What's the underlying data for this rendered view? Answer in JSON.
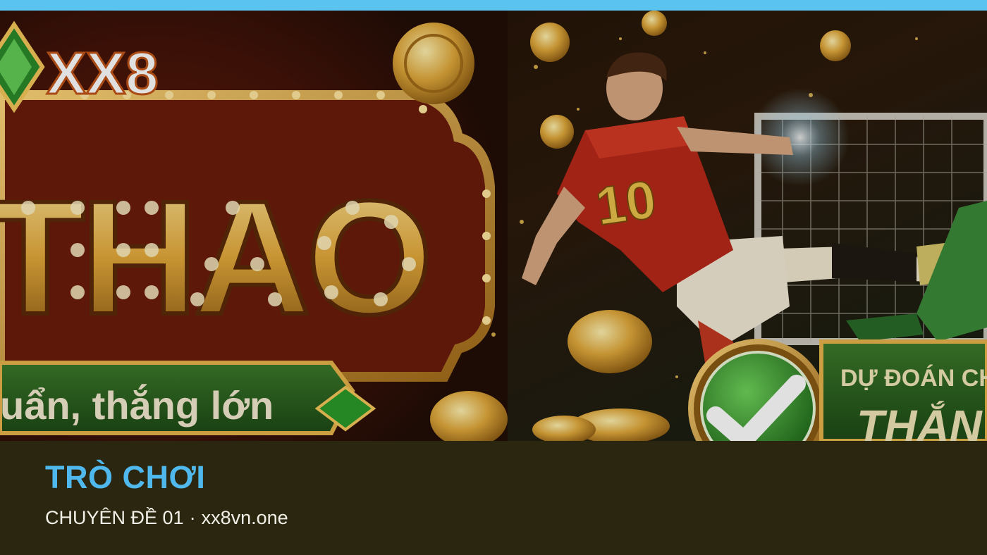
{
  "colors": {
    "top_bar": "#5bc3f0",
    "caption_bg": "#2b2610",
    "title": "#4fb8ec",
    "meta": "#f1efe6"
  },
  "banner": {
    "logo_text": "XX8",
    "headline": "THAO",
    "tagline": "uẩn, thắng lớn",
    "side_banner_line1": "DỰ ĐOÁN CHI",
    "side_banner_line2": "THẮN",
    "jersey_number": "10",
    "icons": [
      "diamond-icon",
      "coin-icon",
      "check-icon",
      "football-player-illustration",
      "goal-net-illustration"
    ]
  },
  "caption": {
    "title": "TRÒ CHƠI",
    "category": "CHUYÊN ĐỀ 01",
    "separator": "·",
    "site": "xx8vn.one"
  }
}
